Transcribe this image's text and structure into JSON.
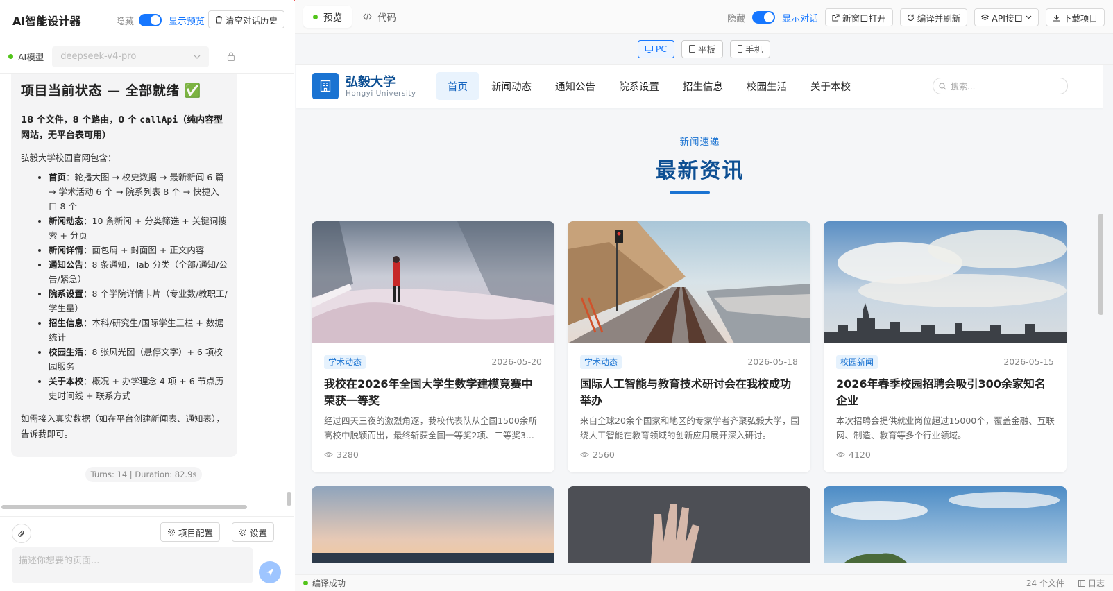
{
  "left": {
    "title": "AI智能设计器",
    "toggle_off": "隐藏",
    "toggle_on": "显示预览",
    "clear_btn": "清空对话历史",
    "model_label": "AI模型",
    "model_value": "deepseek-v4-pro",
    "chat": {
      "heading": "项目当前状态 — 全部就绪 ✅",
      "summary_a": "18 个文件，8 个路由，0 个 ",
      "summary_code": "callApi",
      "summary_b": "（纯内容型网站，无平台表可用）",
      "intro": "弘毅大学校园官网包含：",
      "items": [
        {
          "k": "首页",
          "v": "：轮播大图 → 校史数据 → 最新新闻 6 篇 → 学术活动 6 个 → 院系列表 8 个 → 快捷入口 8 个"
        },
        {
          "k": "新闻动态",
          "v": "：10 条新闻 + 分类筛选 + 关键词搜索 + 分页"
        },
        {
          "k": "新闻详情",
          "v": "：面包屑 + 封面图 + 正文内容"
        },
        {
          "k": "通知公告",
          "v": "：8 条通知，Tab 分类（全部/通知/公告/紧急）"
        },
        {
          "k": "院系设置",
          "v": "：8 个学院详情卡片（专业数/教职工/学生量）"
        },
        {
          "k": "招生信息",
          "v": "：本科/研究生/国际学生三栏 + 数据统计"
        },
        {
          "k": "校园生活",
          "v": "：8 张风光图（悬停文字）+ 6 项校园服务"
        },
        {
          "k": "关于本校",
          "v": "：概况 + 办学理念 4 项 + 6 节点历史时间线 + 联系方式"
        }
      ],
      "outro": "如需接入真实数据（如在平台创建新闻表、通知表），告诉我即可。"
    },
    "turns": "Turns: 14 | Duration: 82.9s",
    "project_btn": "项目配置",
    "settings_btn": "设置",
    "prompt_placeholder": "描述你想要的页面..."
  },
  "right": {
    "tab_preview": "预览",
    "tab_code": "代码",
    "toggle_off": "隐藏",
    "toggle_on": "显示对话",
    "btn_open": "新窗口打开",
    "btn_compile": "编译并刷新",
    "btn_api": "API接口",
    "btn_download": "下载项目",
    "devices": [
      "PC",
      "平板",
      "手机"
    ],
    "status_left": "编译成功",
    "status_files": "24 个文件",
    "status_log": "日志"
  },
  "site": {
    "name": "弘毅大学",
    "name_en": "Hongyi University",
    "nav": [
      "首页",
      "新闻动态",
      "通知公告",
      "院系设置",
      "招生信息",
      "校园生活",
      "关于本校"
    ],
    "search_placeholder": "搜索...",
    "eyebrow": "新闻速递",
    "section_title": "最新资讯",
    "cards": [
      {
        "tag": "学术动态",
        "date": "2026-05-20",
        "title": "我校在2026年全国大学生数学建模竞赛中荣获一等奖",
        "desc": "经过四天三夜的激烈角逐，我校代表队从全国1500余所高校中脱颖而出，最终斩获全国一等奖2项、二等奖3...",
        "views": "3280"
      },
      {
        "tag": "学术动态",
        "date": "2026-05-18",
        "title": "国际人工智能与教育技术研讨会在我校成功举办",
        "desc": "来自全球20余个国家和地区的专家学者齐聚弘毅大学，围绕人工智能在教育领域的创新应用展开深入研讨。",
        "views": "2560"
      },
      {
        "tag": "校园新闻",
        "date": "2026-05-15",
        "title": "2026年春季校园招聘会吸引300余家知名企业",
        "desc": "本次招聘会提供就业岗位超过15000个，覆盖金融、互联网、制造、教育等多个行业领域。",
        "views": "4120"
      }
    ]
  },
  "colors": {
    "primary": "#1677ff",
    "site_blue": "#1a73d2",
    "site_dark": "#0d4f93"
  }
}
